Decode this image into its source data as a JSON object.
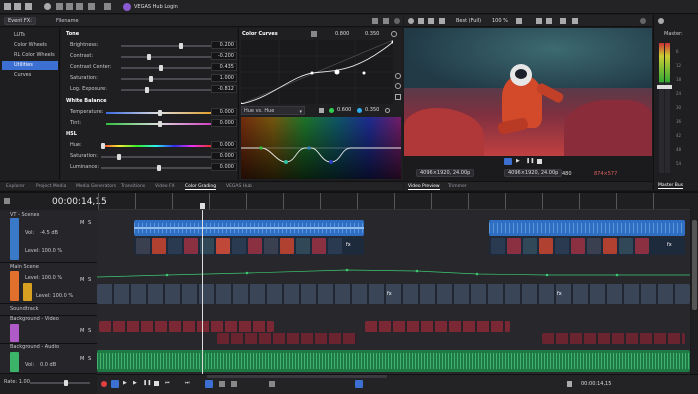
{
  "app": {
    "hub_label": "VEGAS Hub Login"
  },
  "event_fx": {
    "title": "Event FX:",
    "filename": "Filename"
  },
  "plugin_list": [
    "LUTs",
    "Color Wheels",
    "RL Color Wheels",
    "Utilities",
    "Curves"
  ],
  "tone": {
    "section": "Tone",
    "rows": [
      {
        "label": "Brightness:",
        "value": "0.200"
      },
      {
        "label": "Contrast:",
        "value": "-0.200"
      },
      {
        "label": "Contrast Center:",
        "value": "0.435"
      },
      {
        "label": "Saturation:",
        "value": "1.000"
      },
      {
        "label": "Log. Exposure:",
        "value": "-0.812"
      }
    ]
  },
  "white_balance": {
    "section": "White Balance",
    "rows": [
      {
        "label": "Temperature:",
        "value": "0.000"
      },
      {
        "label": "Tint:",
        "value": "0.000"
      }
    ]
  },
  "hsl": {
    "section": "HSL",
    "rows": [
      {
        "label": "Hue:",
        "value": "0.000"
      },
      {
        "label": "Saturation:",
        "value": "0.000"
      },
      {
        "label": "Luminance:",
        "value": "0.000"
      }
    ]
  },
  "curves": {
    "title": "Color Curves",
    "x": "0.800",
    "y": "0.350",
    "hue_mode": "Hue vs. Hue",
    "hx": "0.600",
    "hy": "0.350"
  },
  "lower_tabs": [
    "Explorer",
    "Project Media",
    "Media Generators",
    "Transitions",
    "Video FX",
    "Color Grading",
    "VEGAS Hub"
  ],
  "preview": {
    "quality": "Best (Full)",
    "zoom": "100 %",
    "res1": "4096×1920, 24.00p",
    "res2": "4096×1920, 24.00p",
    "frame": "480",
    "coords": "874×577",
    "tabs": [
      "Video Preview",
      "Trimmer"
    ]
  },
  "master": {
    "label": "Master:",
    "tab": "Master Bus",
    "scale": [
      "6",
      "12",
      "18",
      "24",
      "30",
      "36",
      "42",
      "48",
      "54"
    ]
  },
  "timeline": {
    "timecode": "00:00:14,15",
    "end_tc": "00:00:14,15",
    "rate": "Rate: 1.00"
  },
  "tracks": [
    {
      "name": "VT - Scenes",
      "vol": "Vol:",
      "vol_val": "-4.5 dB",
      "level": "Level: 100.0 %",
      "color": "#3a78c8"
    },
    {
      "name": "Main Scene",
      "level": "Level: 100.0 %",
      "level2": "Level: 100.0 %",
      "color": "#e0702c"
    },
    {
      "name": "Soundtrack",
      "color": "#c4a000"
    },
    {
      "name": "Background - Video",
      "color": "#b05ac8"
    },
    {
      "name": "Background - Audio",
      "vol": "Vol:",
      "vol_val": "0.0 dB",
      "color": "#3bb46a"
    }
  ],
  "colors": {
    "accent": "#3b6fd1",
    "audio_blue": "#2e6fc4",
    "audio_green": "#1e9a52"
  }
}
